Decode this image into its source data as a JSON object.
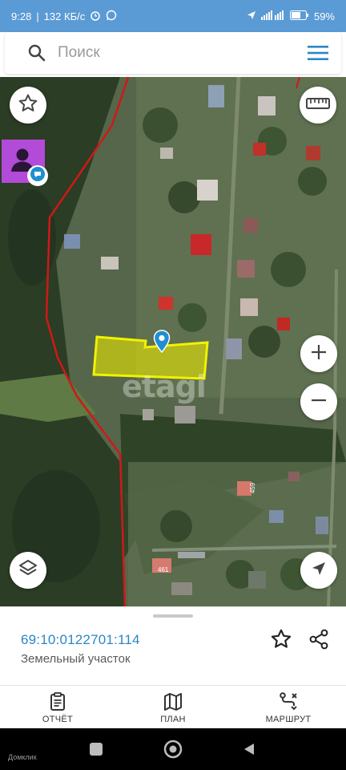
{
  "statusbar": {
    "time": "9:28",
    "speed": "132 КБ/с",
    "battery": "59%"
  },
  "search": {
    "placeholder": "Поиск"
  },
  "map": {
    "watermark": "etagi",
    "house_labels": [
      "461",
      "459"
    ]
  },
  "parcel": {
    "number": "69:10:0122701:114",
    "type": "Земельный участок"
  },
  "tabs": [
    {
      "label": "ОТЧЁТ",
      "icon": "clipboard-icon"
    },
    {
      "label": "ПЛАН",
      "icon": "map-icon"
    },
    {
      "label": "МАРШРУТ",
      "icon": "route-icon"
    }
  ],
  "navbar": {
    "app_label": "Домклик"
  },
  "colors": {
    "accent": "#5b9bd5",
    "link": "#2b86c5",
    "parcel_fill": "#e8e800",
    "border_line": "#d01818"
  }
}
